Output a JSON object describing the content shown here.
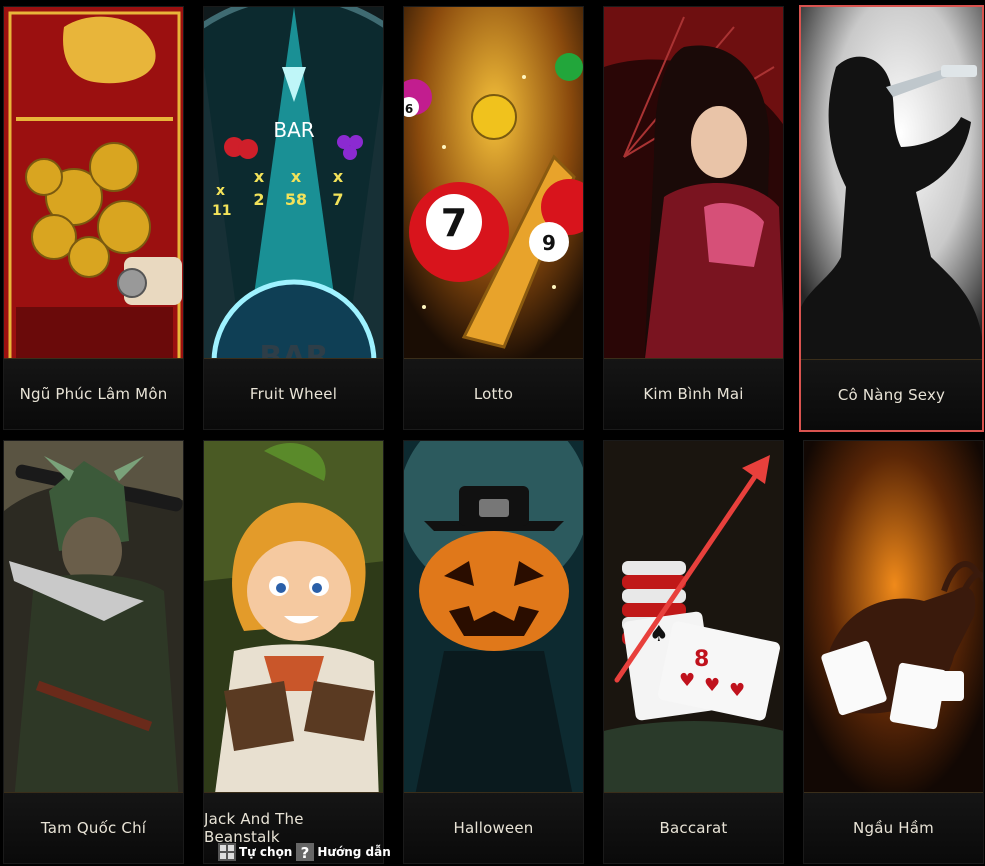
{
  "games": [
    {
      "label": "Ngũ Phúc Lâm Môn",
      "selected": false
    },
    {
      "label": "Fruit Wheel",
      "selected": false
    },
    {
      "label": "Lotto",
      "selected": false
    },
    {
      "label": "Kim Bình Mai",
      "selected": false
    },
    {
      "label": "Cô Nàng Sexy",
      "selected": true
    },
    {
      "label": "Tam Quốc Chí",
      "selected": false
    },
    {
      "label": "Jack And The Beanstalk",
      "selected": false
    },
    {
      "label": "Halloween",
      "selected": false
    },
    {
      "label": "Baccarat",
      "selected": false
    },
    {
      "label": "Ngầu Hầm",
      "selected": false
    }
  ],
  "art_text": {
    "fruit_wheel_top": "BAR",
    "fruit_wheel_bottom": "BAR",
    "fruit_wheel_x2": "x\n2",
    "fruit_wheel_x58": "x\n58",
    "fruit_wheel_x7": "x\n7",
    "fruit_wheel_x11": "x\n11",
    "lotto_ball_7": "7",
    "lotto_ball_6": "6",
    "lotto_ball_9": "9",
    "baccarat_card": "8"
  },
  "toolbar": {
    "custom_label": "Tự chọn",
    "guide_label": "Hướng dẫn"
  },
  "colors": {
    "selected_border": "#d9534f",
    "annotation_arrow": "#e8403c"
  },
  "icons": {
    "custom": "grid-icon",
    "guide": "help-icon"
  }
}
